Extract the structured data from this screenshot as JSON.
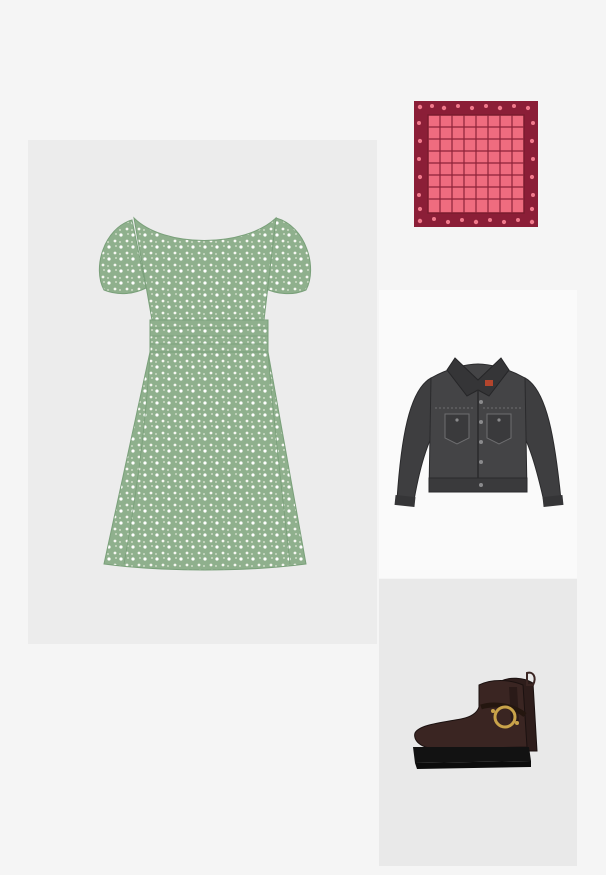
{
  "outfit": {
    "items": [
      {
        "id": "dress",
        "icon": "floral-dress-icon",
        "color": "#8fb08d"
      },
      {
        "id": "scarf",
        "icon": "square-scarf-icon",
        "color": "#ef6c7f"
      },
      {
        "id": "jacket",
        "icon": "denim-jacket-icon",
        "color": "#3b3b3d"
      },
      {
        "id": "boots",
        "icon": "ankle-boot-icon",
        "color": "#3a2522"
      }
    ]
  }
}
